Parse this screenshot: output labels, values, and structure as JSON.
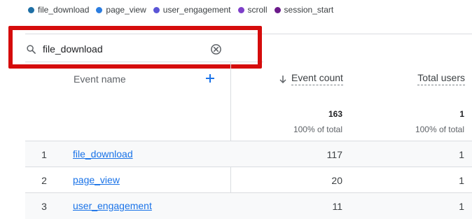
{
  "legend": [
    {
      "label": "file_download",
      "color": "#1e6fa5"
    },
    {
      "label": "page_view",
      "color": "#2b7de0"
    },
    {
      "label": "user_engagement",
      "color": "#5a55d6"
    },
    {
      "label": "scroll",
      "color": "#7e3fc9"
    },
    {
      "label": "session_start",
      "color": "#6b1a8a"
    }
  ],
  "search": {
    "value": "file_download"
  },
  "columns": {
    "event_name": "Event name",
    "event_count": "Event count",
    "total_users": "Total users"
  },
  "totals": {
    "event_count": "163",
    "event_count_pct": "100% of total",
    "total_users": "1",
    "total_users_pct": "100% of total"
  },
  "rows": [
    {
      "index": "1",
      "event_name": "file_download",
      "event_count": "117",
      "total_users": "1"
    },
    {
      "index": "2",
      "event_name": "page_view",
      "event_count": "20",
      "total_users": "1"
    },
    {
      "index": "3",
      "event_name": "user_engagement",
      "event_count": "11",
      "total_users": "1"
    }
  ]
}
